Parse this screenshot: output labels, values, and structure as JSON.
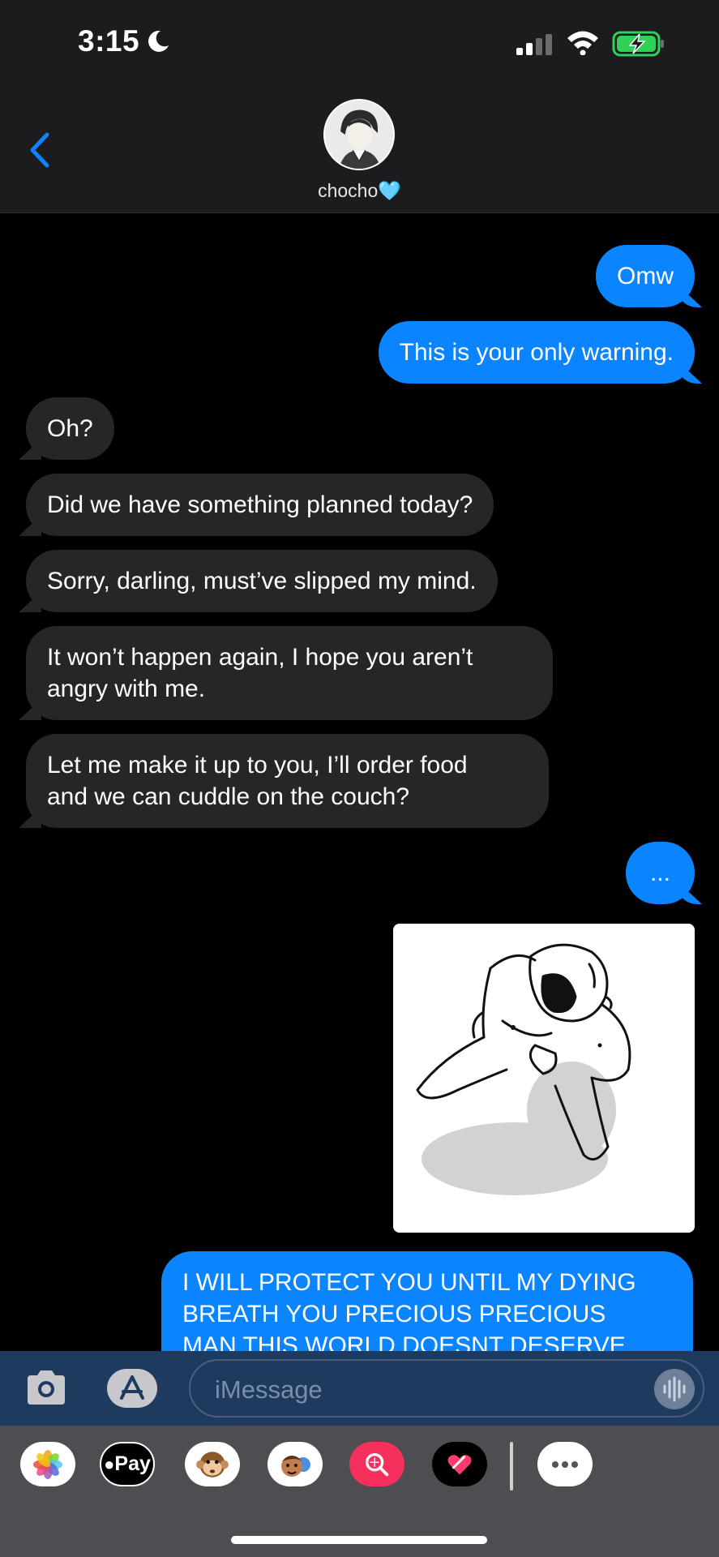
{
  "status_bar": {
    "time": "3:15"
  },
  "header": {
    "contact_name": "chocho🩵"
  },
  "messages": [
    {
      "side": "out",
      "text": "Omw"
    },
    {
      "side": "out",
      "text": "This is your only warning."
    },
    {
      "side": "in",
      "text": "Oh?"
    },
    {
      "side": "in",
      "text": "Did we have something planned today?"
    },
    {
      "side": "in",
      "text": "Sorry, darling, must’ve slipped my mind."
    },
    {
      "side": "in",
      "text": "It won’t happen again, I hope you aren’t\nangry with me."
    },
    {
      "side": "in",
      "text": "Let me make it up to you, I’ll order food\nand we can cuddle on the couch?"
    },
    {
      "side": "out",
      "text": "..."
    },
    {
      "side": "out",
      "text": "I WILL PROTECT YOU UNTIL MY DYING\nBREATH YOU PRECIOUS PRECIOUS\nMAN THIS WORLD DOESNT DESERVE"
    }
  ],
  "input": {
    "placeholder": "iMessage"
  },
  "drawer": {
    "apps": [
      {
        "icon": "photos-icon"
      },
      {
        "icon": "apple-pay-icon",
        "label": "Pay"
      },
      {
        "icon": "monkey-memoji-icon"
      },
      {
        "icon": "memoji-stickers-icon"
      },
      {
        "icon": "search-images-icon"
      },
      {
        "icon": "digital-touch-icon"
      },
      {
        "icon": "more-apps-icon"
      }
    ]
  },
  "colors": {
    "outgoing": "#0a84ff",
    "incoming": "#262628",
    "header": "#1c1c1e"
  }
}
